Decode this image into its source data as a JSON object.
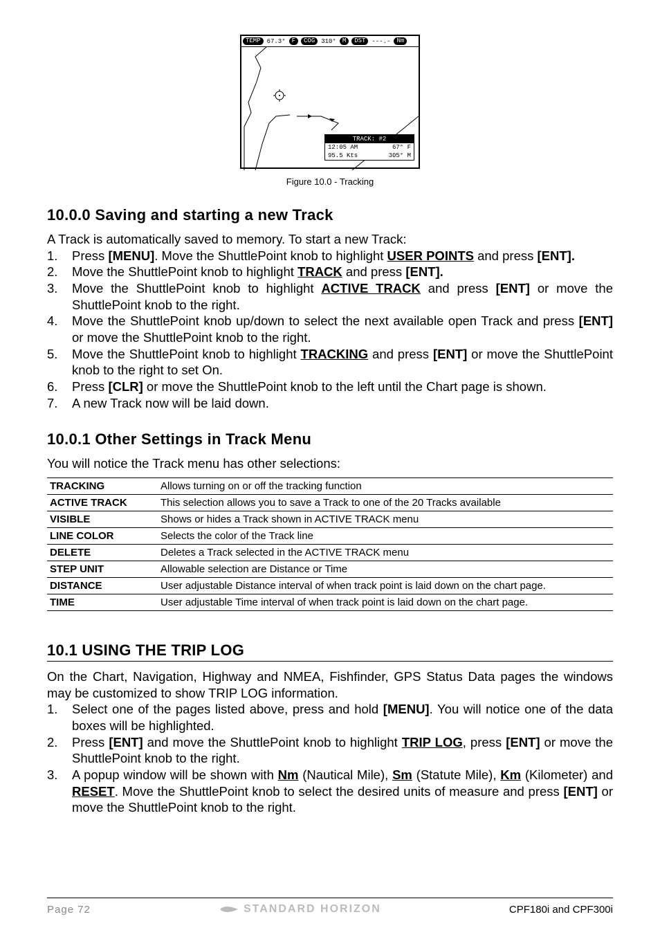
{
  "figure": {
    "top_bar": {
      "temp_label": "TEMP",
      "temp_val": "67.3°",
      "f": "F",
      "cog_label": "COG",
      "cog_val": "310°",
      "m": "M",
      "dst_label": "DST",
      "dst_val": "---.-",
      "nm": "Nm"
    },
    "panel": {
      "head": "TRACK: #2",
      "r1a": "12:05 AM",
      "r1b": "67° F",
      "r2a": "95.5 Kts",
      "r2b": "305° M"
    },
    "caption": "Figure 10.0 - Tracking"
  },
  "sec1": {
    "title": "10.0.0  Saving and starting a new Track",
    "intro": "A Track is automatically saved to memory. To start a new Track:",
    "steps": [
      {
        "n": "1.",
        "pre": "Press ",
        "k1": "[MENU]",
        "mid": ". Move the ShuttlePoint knob to highlight ",
        "u": "USER POINTS",
        "post": " and press ",
        "k2": "[ENT].",
        "tail": ""
      },
      {
        "n": "2.",
        "pre": "Move the ShuttlePoint knob to highlight ",
        "u": "TRACK",
        "mid": " and press ",
        "k1": "[ENT].",
        "post": "",
        "tail": ""
      },
      {
        "n": "3.",
        "pre": "Move the ShuttlePoint knob to highlight ",
        "u": "ACTIVE TRACK",
        "mid": "  and press ",
        "k1": "[ENT]",
        "post": " or move the ShuttlePoint knob to the right.",
        "tail": ""
      },
      {
        "n": "4.",
        "pre": "Move the ShuttlePoint knob up/down to select the next available open Track and press ",
        "k1": "[ENT]",
        "post": " or move the ShuttlePoint knob to the right.",
        "tail": ""
      },
      {
        "n": "5.",
        "pre": "Move the ShuttlePoint knob to highlight ",
        "u": "TRACKING",
        "mid": " and press ",
        "k1": "[ENT]",
        "post": " or move the ShuttlePoint knob to the right to set On.",
        "tail": ""
      },
      {
        "n": "6.",
        "pre": "Press ",
        "k1": "[CLR]",
        "post": " or move the ShuttlePoint knob to the left until the Chart page is shown.",
        "tail": ""
      },
      {
        "n": "7.",
        "pre": "A new Track now will be laid down.",
        "post": "",
        "tail": ""
      }
    ]
  },
  "sec2": {
    "title": "10.0.1  Other Settings in Track Menu",
    "intro": "You will notice the Track menu has other selections:",
    "rows": [
      {
        "k": "TRACKING",
        "v": "Allows turning on or off the tracking function"
      },
      {
        "k": "ACTIVE TRACK",
        "v": "This selection allows you to save a Track to one of the 20 Tracks available"
      },
      {
        "k": "VISIBLE",
        "v": "Shows or hides a Track shown in ACTIVE TRACK menu"
      },
      {
        "k": "LINE COLOR",
        "v": "Selects the color of the Track line"
      },
      {
        "k": "DELETE",
        "v": "Deletes a Track selected in the ACTIVE TRACK menu"
      },
      {
        "k": "STEP UNIT",
        "v": "Allowable selection are Distance or Time"
      },
      {
        "k": "DISTANCE",
        "v": "User adjustable Distance interval of when track point is laid down on the chart page."
      },
      {
        "k": "TIME",
        "v": "User adjustable Time interval of when track point is laid down on the chart page."
      }
    ]
  },
  "sec3": {
    "title": "10.1   USING THE TRIP LOG",
    "intro": "On the Chart, Navigation, Highway and NMEA, Fishfinder, GPS Status Data pages the windows may be customized to show TRIP LOG information.",
    "steps": [
      {
        "n": "1.",
        "t": "Select one of the pages listed above, press and hold ",
        "k": "[MENU]",
        "post": ". You will notice one of the data boxes will be highlighted."
      },
      {
        "n": "2.",
        "t": "Press ",
        "k": "[ENT]",
        "mid": " and move the ShuttlePoint knob to highlight  ",
        "u": "TRIP LOG",
        "post2": ", press ",
        "k2": "[ENT]",
        "tail": " or move the ShuttlePoint knob to the right."
      },
      {
        "n": "3.",
        "t": "A popup window will be shown with ",
        "u1": "Nm",
        "p1": " (Nautical Mile), ",
        "u2": "Sm",
        "p2": " (Statute Mile), ",
        "u3": "Km",
        "p3": " (Kilometer) and ",
        "u4": "RESET",
        "p4": ". Move the ShuttlePoint knob to select the desired units of measure and press ",
        "k": "[ENT]",
        "tail": " or move the ShuttlePoint knob to the right."
      }
    ]
  },
  "footer": {
    "page": "Page 72",
    "logo": "STANDARD HORIZON",
    "right": "CPF180i and CPF300i"
  }
}
